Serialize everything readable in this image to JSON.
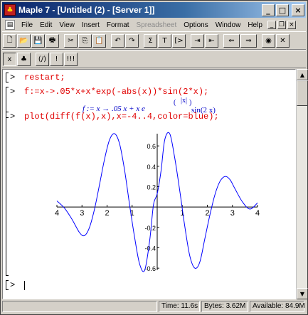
{
  "window": {
    "title": "Maple 7 - [Untitled (2) - [Server 1]]",
    "app_icon": "maple-leaf-icon",
    "buttons": {
      "minimize": "_",
      "maximize": "□",
      "close": "×"
    }
  },
  "menubar": {
    "items": [
      {
        "label": "File",
        "enabled": true
      },
      {
        "label": "Edit",
        "enabled": true
      },
      {
        "label": "View",
        "enabled": true
      },
      {
        "label": "Insert",
        "enabled": true
      },
      {
        "label": "Format",
        "enabled": true
      },
      {
        "label": "Spreadsheet",
        "enabled": false
      },
      {
        "label": "Options",
        "enabled": true
      },
      {
        "label": "Window",
        "enabled": true
      },
      {
        "label": "Help",
        "enabled": true
      }
    ]
  },
  "toolbar1": {
    "buttons": [
      {
        "name": "new-document-icon",
        "glyph": "🗋"
      },
      {
        "name": "open-folder-icon",
        "glyph": "📂"
      },
      {
        "name": "save-icon",
        "glyph": "💾"
      },
      {
        "name": "print-icon",
        "glyph": "🖶"
      },
      {
        "name": "cut-icon",
        "glyph": "✂"
      },
      {
        "name": "copy-icon",
        "glyph": "⎘"
      },
      {
        "name": "paste-icon",
        "glyph": "📋"
      },
      {
        "name": "undo-icon",
        "glyph": "↶"
      },
      {
        "name": "redo-icon",
        "glyph": "↷"
      },
      {
        "name": "math-input-icon",
        "glyph": "Σ"
      },
      {
        "name": "text-input-icon",
        "glyph": "T"
      },
      {
        "name": "execution-group-icon",
        "glyph": "[>"
      },
      {
        "name": "expand-section-icon",
        "glyph": "⇥"
      },
      {
        "name": "collapse-section-icon",
        "glyph": "⇤"
      },
      {
        "name": "back-icon",
        "glyph": "⇐"
      },
      {
        "name": "forward-icon",
        "glyph": "⇒"
      },
      {
        "name": "stop-icon",
        "glyph": "◉"
      },
      {
        "name": "restart-icon",
        "glyph": "✕"
      }
    ]
  },
  "toolbar2": {
    "buttons": [
      {
        "name": "symbolic-icon",
        "glyph": "x"
      },
      {
        "name": "maple-leaf-icon",
        "glyph": "♣"
      },
      {
        "name": "execute-icon",
        "glyph": "(/)"
      },
      {
        "name": "execute-selection-icon",
        "glyph": "!"
      },
      {
        "name": "execute-worksheet-icon",
        "glyph": "!!!"
      }
    ]
  },
  "worksheet": {
    "prompt": ">",
    "groups": [
      {
        "input": "restart;"
      },
      {
        "input": "f:=x->.05*x+x*exp(-abs(x))*sin(2*x);"
      },
      {
        "output": {
          "lhs": "f := x → .05 x + x e",
          "exponent_abs": "|x|",
          "exponent_paren_open": "(",
          "exponent_paren_close": ")",
          "tail": "sin(2 x)"
        }
      },
      {
        "input": "plot(diff(f(x),x),x=-4..4,color=blue);"
      }
    ]
  },
  "chart_data": {
    "type": "line",
    "title": "",
    "xlabel": "",
    "ylabel": "",
    "xlim": [
      -4,
      4
    ],
    "ylim": [
      -0.62,
      0.72
    ],
    "x_ticks": [
      -4,
      -3,
      -2,
      -1,
      0,
      1,
      2,
      3,
      4
    ],
    "x_tick_labels": [
      "4",
      "3",
      "2",
      "1",
      "",
      "1",
      "2",
      "3",
      "4"
    ],
    "y_ticks": [
      0.6,
      0.4,
      0.2,
      -0.2,
      -0.4,
      -0.6
    ],
    "y_tick_labels": [
      "0.6",
      "0.4",
      "0.2",
      "-0.2",
      "-0.4",
      "-0.6"
    ],
    "grid": false,
    "series": [
      {
        "color": "#0000ff",
        "x": [
          -4.0,
          -3.7,
          -3.4,
          -3.1,
          -2.9,
          -2.7,
          -2.5,
          -2.3,
          -2.1,
          -1.9,
          -1.7,
          -1.5,
          -1.3,
          -1.1,
          -0.9,
          -0.7,
          -0.5,
          -0.3,
          -0.15,
          0.0,
          0.15,
          0.3,
          0.5,
          0.7,
          0.9,
          1.1,
          1.3,
          1.5,
          1.7,
          1.9,
          2.1,
          2.3,
          2.5,
          2.7,
          2.9,
          3.1,
          3.4,
          3.7,
          4.0
        ],
        "y": [
          0.06,
          -0.01,
          -0.12,
          -0.25,
          -0.28,
          -0.2,
          -0.02,
          0.22,
          0.47,
          0.66,
          0.72,
          0.62,
          0.36,
          0.02,
          -0.3,
          -0.56,
          -0.62,
          -0.33,
          0.02,
          0.13,
          0.35,
          0.66,
          0.72,
          0.48,
          0.16,
          -0.19,
          -0.48,
          -0.6,
          -0.54,
          -0.31,
          -0.08,
          0.12,
          0.25,
          0.3,
          0.27,
          0.18,
          0.05,
          -0.02,
          0.04
        ]
      }
    ]
  },
  "statusbar": {
    "time": "Time: 11.6s",
    "bytes": "Bytes: 3.62M",
    "available": "Available: 84.9M"
  }
}
